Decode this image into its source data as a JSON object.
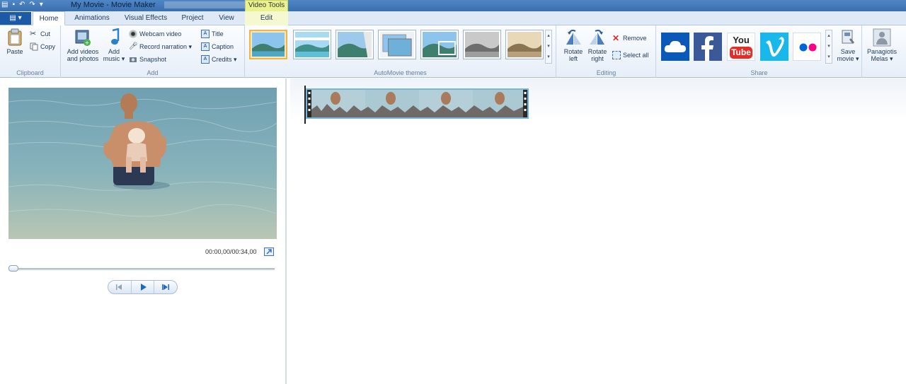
{
  "window": {
    "title": "My Movie - Movie Maker",
    "context_tab": "Video Tools"
  },
  "qat": {
    "icons": [
      "film-icon",
      "save-icon",
      "undo-icon",
      "redo-icon",
      "dropdown-icon"
    ]
  },
  "tabs": {
    "file_label": "▤ ▾",
    "items": [
      {
        "label": "Home",
        "active": true
      },
      {
        "label": "Animations"
      },
      {
        "label": "Visual Effects"
      },
      {
        "label": "Project"
      },
      {
        "label": "View"
      },
      {
        "label": "Edit",
        "context": true
      }
    ]
  },
  "ribbon": {
    "clipboard": {
      "label": "Clipboard",
      "paste": "Paste",
      "cut": "Cut",
      "copy": "Copy"
    },
    "add": {
      "label": "Add",
      "add_videos_line1": "Add videos",
      "add_videos_line2": "and photos",
      "add_music_line1": "Add",
      "add_music_line2": "music ▾",
      "webcam": "Webcam video",
      "narration": "Record narration ▾",
      "snapshot": "Snapshot",
      "title": "Title",
      "caption": "Caption",
      "credits": "Credits ▾"
    },
    "automovie": {
      "label": "AutoMovie themes",
      "themes": [
        {
          "name": "default-theme-icon",
          "selected": true
        },
        {
          "name": "contemporary-theme-icon"
        },
        {
          "name": "fade-theme-icon"
        },
        {
          "name": "pan-zoom-theme-icon"
        },
        {
          "name": "cinematic-theme-icon"
        },
        {
          "name": "black-white-theme-icon"
        },
        {
          "name": "sepia-theme-icon"
        }
      ]
    },
    "editing": {
      "label": "Editing",
      "rotate_left_line1": "Rotate",
      "rotate_left_line2": "left",
      "rotate_right_line1": "Rotate",
      "rotate_right_line2": "right",
      "remove": "Remove",
      "select_all": "Select all"
    },
    "share": {
      "label": "Share",
      "services": [
        "onedrive-icon",
        "facebook-icon",
        "youtube-icon",
        "vimeo-icon",
        "flickr-icon"
      ],
      "youtube_you": "You",
      "youtube_tube": "Tube",
      "save_line1": "Save",
      "save_line2": "movie ▾"
    },
    "account": {
      "name_line1": "Panagiotis",
      "name_line2": "Melas ▾"
    }
  },
  "preview": {
    "time": "00:00,00/00:34,00",
    "progress": 0
  },
  "colors": {
    "accent": "#1d5aa6",
    "context_tab": "#e9f28f",
    "selected_theme": "#f0b54a"
  }
}
